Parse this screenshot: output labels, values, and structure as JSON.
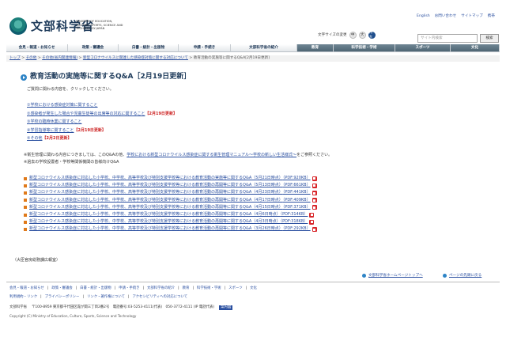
{
  "header": {
    "logo_text": "文部科学省",
    "logo_sub": "MINISTRY OF EDUCATION, CULTURE, SPORTS, SCIENCE AND TECHNOLOGY-JAPAN",
    "util_links": [
      "English",
      "お問い合わせ",
      "サイトマップ",
      "携帯"
    ],
    "font_size_label": "文字サイズの変更",
    "font_sizes": [
      "中",
      "大",
      "特大"
    ],
    "search_placeholder": "サイト内検索",
    "search_button": "検索"
  },
  "nav": {
    "items": [
      "会見・報道・お知らせ",
      "政策・審議会",
      "白書・統計・出版物",
      "申請・手続き",
      "文部科学省の紹介",
      "教育",
      "科学技術・学術",
      "スポーツ",
      "文化"
    ]
  },
  "breadcrumb": {
    "items": [
      "トップ",
      "その他",
      "その他(省内関連情報)",
      "新型コロナウイルスに関連した感染症対策に関する対応について"
    ],
    "current": "教育活動の実施等に関するQ&A[2月19日更新]"
  },
  "main": {
    "title": "教育活動の実施等に関するQ&A［2月19日更新］",
    "intro": "ご質問に関わる内容を、クリックしてください。",
    "topics": [
      {
        "text": "①学校における感染症対策に関すること",
        "tag": ""
      },
      {
        "text": "②感染者が発生した場合や児童生徒等の出席等の対応に関すること",
        "tag": "【2月19日更新】"
      },
      {
        "text": "③学校の臨時休業に関すること",
        "tag": ""
      },
      {
        "text": "④学習指導等に関すること",
        "tag": "【2月19日更新】"
      },
      {
        "text": "⑤その他",
        "tag": "【2月2日更新】"
      }
    ],
    "note1_pre": "※衛生管理に関わる内容につきましては、このQ&Aの他、",
    "note1_link": "学校における新型コロナウイルス感染症に関する衛生管理マニュアル〜学校の新しい生活様式〜",
    "note1_post": "をご参照ください。",
    "note2": "※過去の学校設置者・学校等関係機関の皆様向けQ&A",
    "pdfs": [
      {
        "text": "新型コロナウイルス感染症に対応した小学校、中学校、高等学校及び特別支援学校等における教育活動の実施等に関するQ&A（5月21日時点）",
        "size": "（PDF:920KB）"
      },
      {
        "text": "新型コロナウイルス感染症に対応した小学校、中学校、高等学校及び特別支援学校等における教育活動の再開等に関するQ&A（5月13日時点）",
        "size": "（PDF:661KB）"
      },
      {
        "text": "新型コロナウイルス感染症に対応した小学校、中学校、高等学校及び特別支援学校等における教育活動の再開等に関するQ&A（4月23日時点）",
        "size": "（PDF:441KB）"
      },
      {
        "text": "新型コロナウイルス感染症に対応した小学校、中学校、高等学校及び特別支援学校等における教育活動の再開等に関するQ&A（4月17日時点）",
        "size": "（PDF:409KB）"
      },
      {
        "text": "新型コロナウイルス感染症に対応した小学校、中学校、高等学校及び特別支援学校等における教育活動の再開等に関するQ&A（4月15日時点）",
        "size": "（PDF:371KB）"
      },
      {
        "text": "新型コロナウイルス感染症に対応した小学校、中学校、高等学校及び特別支援学校等における教育活動の再開等に関するQ&A（4月6日時点）",
        "size": "（PDF:314KB）"
      },
      {
        "text": "新型コロナウイルス感染症に対応した小学校、中学校、高等学校及び特別支援学校等における教育活動の再開等に関するQ&A（4月3日時点）",
        "size": "（PDF:318KB）"
      },
      {
        "text": "新型コロナウイルス感染症に対応した小学校、中学校、高等学校及び特別支援学校等における教育活動の再開等に関するQ&A（3月26日時点）",
        "size": "（PDF:292KB）"
      }
    ],
    "contact": "（大臣官房総務課広報室）"
  },
  "footer": {
    "top_links": [
      "文部科学省ホームページトップへ",
      "ページの先頭に戻る"
    ],
    "row1": [
      "会見・報道・お知らせ",
      "政策・審議会",
      "白書・統計・出版物",
      "申請・手続き",
      "文部科学省の紹介",
      "教育",
      "科学技術・学術",
      "スポーツ",
      "文化"
    ],
    "row2": [
      "利用規約・リンク",
      "プライバシーポリシー",
      "リンク・著作権について",
      "アクセシビリティへの対応について"
    ],
    "address_name": "文部科学省",
    "address": "〒100-8959 東京都千代田区霞が関三丁目2番2号　電話番号:03-5253-4111(代表)　050-3772-4111 (IP 電話代表)",
    "map": "案内図",
    "copyright": "Copyright (C) Ministry of Education, Culture, Sports, Science and Technology"
  }
}
